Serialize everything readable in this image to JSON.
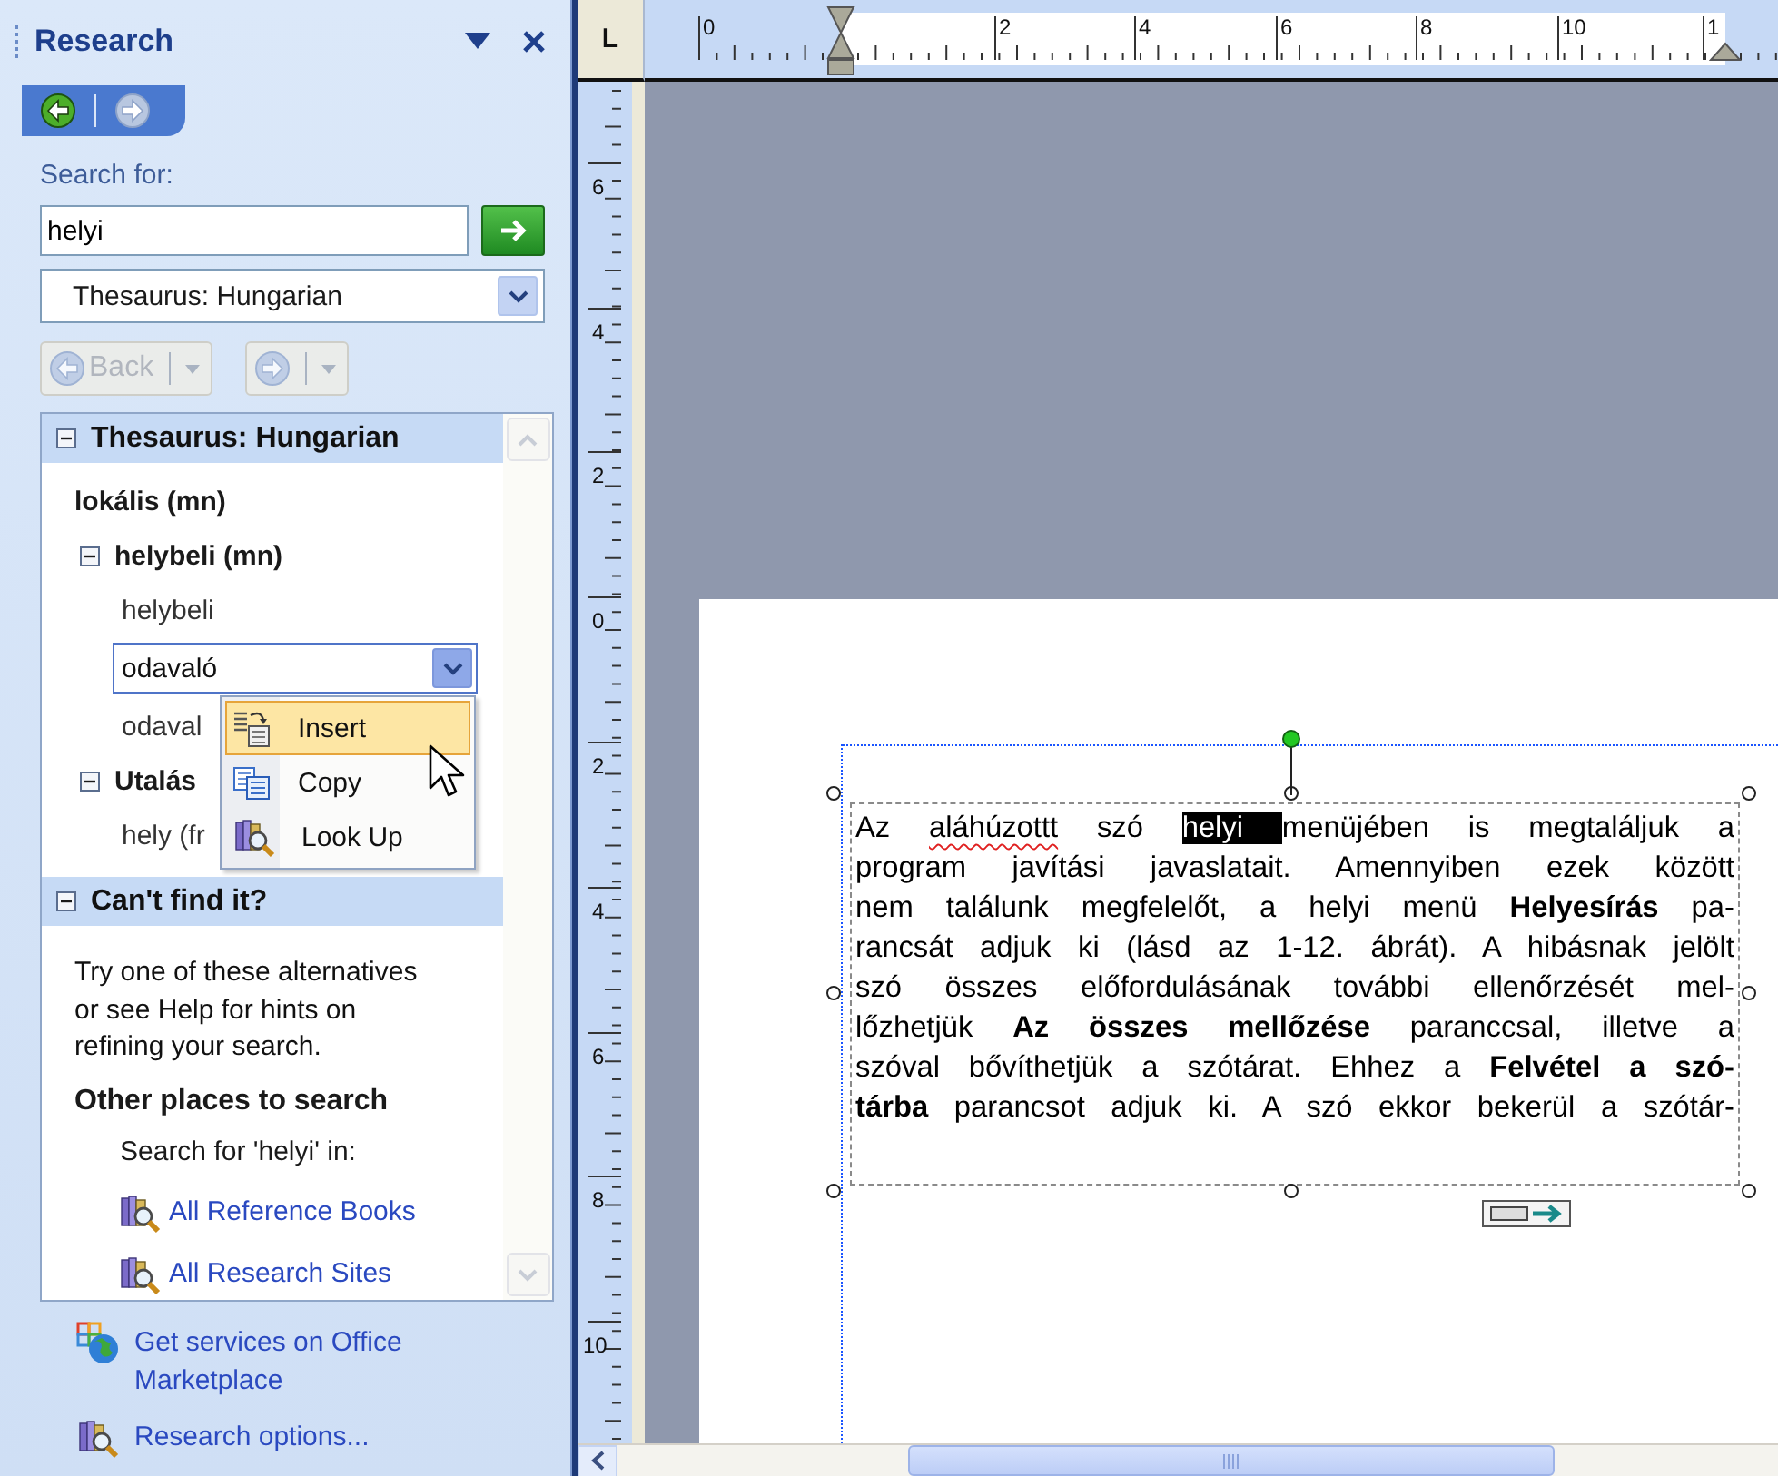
{
  "pane": {
    "title": "Research",
    "search": {
      "label": "Search for:",
      "value": "helyi"
    },
    "source": {
      "value": "Thesaurus: Hungarian"
    },
    "nav": {
      "back_label": "Back",
      "back_disabled": true,
      "forward_disabled": true
    },
    "sections": [
      {
        "title": "Thesaurus: Hungarian",
        "kind": "thesaurus",
        "expanded": true,
        "items": [
          {
            "text": "lokális (mn)",
            "kind": "heading"
          },
          {
            "text": "helybeli (mn)",
            "kind": "group",
            "expanded": true,
            "children": [
              {
                "text": "helybeli",
                "selected": false
              },
              {
                "text": "odavaló",
                "selected": true
              },
              {
                "text": "odaval",
                "selected": false
              }
            ]
          },
          {
            "text": "Utalás",
            "kind": "group",
            "expanded": true,
            "children": [
              {
                "text": "hely (fr",
                "selected": false
              }
            ]
          }
        ]
      },
      {
        "title": "Can't find it?",
        "kind": "help",
        "expanded": true,
        "text": "Try one of these alternatives or see Help for hints on refining your search.",
        "subheading": "Other places to search",
        "search_in": "Search for 'helyi' in:",
        "links": [
          "All Reference Books",
          "All Research Sites"
        ]
      }
    ],
    "footer_links": [
      {
        "label": "Get services on Office Marketplace",
        "kind": "marketplace"
      },
      {
        "label": "Research options...",
        "kind": "options"
      }
    ],
    "context_menu": [
      {
        "label": "Insert",
        "kind": "insert",
        "selected": true
      },
      {
        "label": "Copy",
        "kind": "copy",
        "selected": false
      },
      {
        "label": "Look Up",
        "kind": "lookup",
        "selected": false
      }
    ]
  },
  "document": {
    "tab_selector": "L",
    "h_ruler": [
      "0",
      "2",
      "4",
      "6",
      "8",
      "10",
      "1"
    ],
    "v_ruler": [
      "6",
      "4",
      "2",
      "0",
      "2",
      "4",
      "6",
      "8",
      "10"
    ],
    "lines": [
      [
        {
          "text": "Az ",
          "kind": "plain"
        },
        {
          "text": "aláhúzottt",
          "kind": "misspelled"
        },
        {
          "text": " szó ",
          "kind": "plain"
        },
        {
          "text": "helyi ",
          "kind": "selected"
        },
        {
          "text": "menüjében is megtaláljuk a",
          "kind": "plain"
        }
      ],
      [
        {
          "text": "program javítási javaslatait. Amennyiben ezek között",
          "kind": "plain"
        }
      ],
      [
        {
          "text": "nem találunk megfelelőt, a helyi menü ",
          "kind": "plain"
        },
        {
          "text": "Helyesírás",
          "kind": "bold"
        },
        {
          "text": " pa-",
          "kind": "plain"
        }
      ],
      [
        {
          "text": "rancsát adjuk ki (lásd az 1-12. ábrát). A hibásnak jelölt",
          "kind": "plain"
        }
      ],
      [
        {
          "text": "szó összes előfordulásának további ellenőrzését mel-",
          "kind": "plain"
        }
      ],
      [
        {
          "text": "lőzhetjük ",
          "kind": "plain"
        },
        {
          "text": "Az összes mellőzése",
          "kind": "bold"
        },
        {
          "text": " paranccsal, illetve a",
          "kind": "plain"
        }
      ],
      [
        {
          "text": "szóval bővíthetjük a szótárat. Ehhez a ",
          "kind": "plain"
        },
        {
          "text": "Felvétel a szó-",
          "kind": "bold"
        }
      ],
      [
        {
          "text": "tárba",
          "kind": "bold"
        },
        {
          "text": " parancsot adjuk ki. A szó ekkor bekerül a szótár-",
          "kind": "plain"
        }
      ]
    ]
  }
}
